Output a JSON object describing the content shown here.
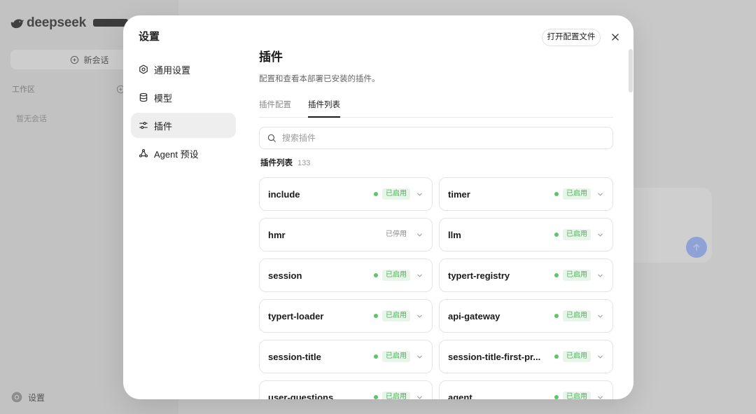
{
  "app": {
    "logo_text": "deepseek",
    "logo_icon": "whale-logo-icon",
    "new_chat_label": "新会话",
    "workspace_label": "工作区",
    "empty_sessions_text": "暂无会话",
    "settings_label": "设置"
  },
  "settings_modal": {
    "title": "设置",
    "open_config_label": "打开配置文件",
    "close_icon": "close-icon",
    "nav": [
      {
        "label": "通用设置",
        "icon": "gear-icon",
        "selected": false
      },
      {
        "label": "模型",
        "icon": "database-icon",
        "selected": false
      },
      {
        "label": "插件",
        "icon": "sliders-icon",
        "selected": true
      },
      {
        "label": "Agent 预设",
        "icon": "nodes-icon",
        "selected": false
      }
    ]
  },
  "plugins_page": {
    "heading": "插件",
    "description": "配置和查看本部署已安装的插件。",
    "tabs": [
      {
        "label": "插件配置",
        "active": false
      },
      {
        "label": "插件列表",
        "active": true
      }
    ],
    "search": {
      "placeholder": "搜索插件",
      "icon": "search-icon"
    },
    "list_title": "插件列表",
    "count": 133,
    "items": [
      {
        "name": "include",
        "status": "已启用",
        "enabled": true
      },
      {
        "name": "timer",
        "status": "已启用",
        "enabled": true
      },
      {
        "name": "hmr",
        "status": "已停用",
        "enabled": false
      },
      {
        "name": "llm",
        "status": "已启用",
        "enabled": true
      },
      {
        "name": "session",
        "status": "已启用",
        "enabled": true
      },
      {
        "name": "typert-registry",
        "status": "已启用",
        "enabled": true
      },
      {
        "name": "typert-loader",
        "status": "已启用",
        "enabled": true
      },
      {
        "name": "api-gateway",
        "status": "已启用",
        "enabled": true
      },
      {
        "name": "session-title",
        "status": "已启用",
        "enabled": true
      },
      {
        "name": "session-title-first-pr...",
        "status": "已启用",
        "enabled": true
      },
      {
        "name": "user-questions",
        "status": "已启用",
        "enabled": true
      },
      {
        "name": "agent",
        "status": "已启用",
        "enabled": true
      }
    ]
  },
  "colors": {
    "status_enabled": "#5cc46a",
    "status_text": "#4fae5c",
    "badge_bg": "#e8f6ea",
    "nav_selected": "#eeeeee",
    "send_button": "#8fa2d6"
  }
}
